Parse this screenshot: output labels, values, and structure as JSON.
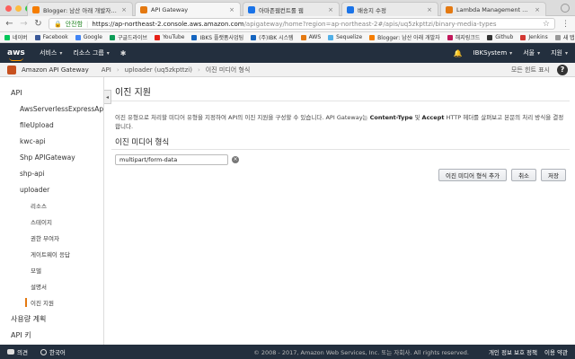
{
  "browser": {
    "tabs": [
      {
        "label": "Blogger: 남산 아래 개발자들 - 새",
        "color": "#f57d00",
        "active": false
      },
      {
        "label": "API Gateway",
        "color": "#e47911",
        "active": true
      },
      {
        "label": "아마존웹컨트롤 웹",
        "color": "#1a73e8",
        "active": false
      },
      {
        "label": "배송지 수정",
        "color": "#1a73e8",
        "active": false
      },
      {
        "label": "Lambda Management Console",
        "color": "#e47911",
        "active": false
      }
    ],
    "secure_label": "안전함",
    "url_host": "https://ap-northeast-2.console.aws.amazon.com",
    "url_path": "/apigateway/home?region=ap-northeast-2#/apis/uq5zkpttzi/binary-media-types",
    "bookmarks": [
      {
        "label": "네이버",
        "color": "#03c75a"
      },
      {
        "label": "Facebook",
        "color": "#3b5998"
      },
      {
        "label": "Google",
        "color": "#4285f4"
      },
      {
        "label": "구글드라이브",
        "color": "#0f9d58"
      },
      {
        "label": "YouTube",
        "color": "#e62117"
      },
      {
        "label": "IBKS 플랫폼사업팀",
        "color": "#1565c0"
      },
      {
        "label": "(주)IBK 시스템",
        "color": "#1565c0"
      },
      {
        "label": "AWS",
        "color": "#e47911"
      },
      {
        "label": "Sequelize",
        "color": "#52b0e7"
      },
      {
        "label": "Blogger: 남산 아래 개발자",
        "color": "#f57d00"
      },
      {
        "label": "해지링크드",
        "color": "#c2185b"
      },
      {
        "label": "Github",
        "color": "#333333"
      },
      {
        "label": "Jenkins",
        "color": "#d33833"
      },
      {
        "label": "새 탭",
        "color": "#999999"
      }
    ]
  },
  "aws_nav": {
    "logo": "aws",
    "services": "서비스",
    "resource_groups": "리소스 그룹",
    "account": "IBKSystem",
    "region": "서울",
    "support": "지원"
  },
  "service_bar": {
    "name": "Amazon API Gateway",
    "breadcrumbs": [
      "API",
      "uploader (uq5zkpttzi)",
      "이진 미디어 형식"
    ],
    "hint": "모든 힌트 표시",
    "help": "?"
  },
  "sidebar": {
    "items": [
      {
        "label": "API",
        "level": 0,
        "active": false
      },
      {
        "label": "AwsServerlessExpressApi",
        "level": 1,
        "active": false
      },
      {
        "label": "fileUpload",
        "level": 1,
        "active": false
      },
      {
        "label": "kwc-api",
        "level": 1,
        "active": false
      },
      {
        "label": "Shp APIGateway",
        "level": 1,
        "active": false
      },
      {
        "label": "shp-api",
        "level": 1,
        "active": false
      },
      {
        "label": "uploader",
        "level": 1,
        "active": false
      },
      {
        "label": "리소스",
        "level": 2,
        "active": false
      },
      {
        "label": "스테이지",
        "level": 2,
        "active": false
      },
      {
        "label": "권한 부여자",
        "level": 2,
        "active": false
      },
      {
        "label": "게이트웨이 응답",
        "level": 2,
        "active": false
      },
      {
        "label": "모델",
        "level": 2,
        "active": false
      },
      {
        "label": "설명서",
        "level": 2,
        "active": false
      },
      {
        "label": "이진 지원",
        "level": 2,
        "active": true
      },
      {
        "label": "사용량 계획",
        "level": 0,
        "active": false
      },
      {
        "label": "API 키",
        "level": 0,
        "active": false
      }
    ]
  },
  "main": {
    "title": "이진 지원",
    "desc_pre": "이진 유형으로 처리할 미디어 유형을 지정하여 API의 이진 지원을 구성할 수 있습니다. API Gateway는 ",
    "desc_b1": "Content-Type",
    "desc_mid": " 및 ",
    "desc_b2": "Accept",
    "desc_post": " HTTP 헤더를 살펴보고 본문의 처리 방식을 결정합니다.",
    "section_title": "이진 미디어 형식",
    "media_type_value": "multipart/form-data",
    "add_button": "이진 미디어 형식 추가",
    "cancel_button": "취소",
    "save_button": "저장"
  },
  "footer": {
    "feedback": "의견",
    "language": "한국어",
    "copyright": "© 2008 - 2017, Amazon Web Services, Inc. 또는 자회사. All rights reserved.",
    "privacy": "개인 정보 보호 정책",
    "terms": "이용 약관"
  }
}
